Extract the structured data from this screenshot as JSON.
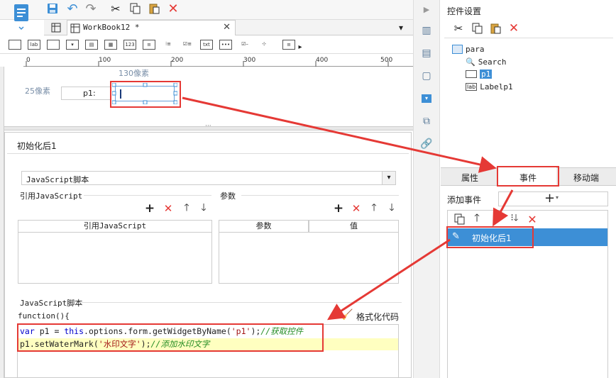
{
  "toolbar": {
    "tab_title": "WorkBook12 *"
  },
  "ruler": {
    "ticks": [
      "0",
      "100",
      "200",
      "300",
      "400",
      "500"
    ]
  },
  "canvas": {
    "width_label": "130像素",
    "height_label": "25像素",
    "param_label": "p1:"
  },
  "editor": {
    "panel_title": "初始化后1",
    "script_type": "JavaScript脚本",
    "ref_section": "引用JavaScript",
    "param_section": "参数",
    "ref_col": "引用JavaScript",
    "param_col": "参数",
    "value_col": "值",
    "script_section": "JavaScript脚本",
    "func_header": "function(){",
    "format_label": "格式化代码",
    "code": {
      "line1_kw": "var",
      "line1_a": " p1 = ",
      "line1_this": "this",
      "line1_b": ".options.form.getWidgetByName(",
      "line1_str": "'p1'",
      "line1_c": ");",
      "line1_cmt": "//获取控件",
      "line2_a": "p1.setWaterMark(",
      "line2_str": "'水印文字'",
      "line2_b": ");",
      "line2_cmt": "//添加水印文字"
    }
  },
  "right_panel": {
    "title": "控件设置",
    "tree": {
      "root": "para",
      "search": "Search",
      "p1": "p1",
      "label": "Labelp1"
    },
    "tabs": {
      "attr": "属性",
      "event": "事件",
      "mobile": "移动端"
    },
    "add_event": "添加事件",
    "event_item": "初始化后1"
  },
  "colors": {
    "accent": "#3d8fd6",
    "selection": "#3d8fd6",
    "highlight": "#e53935",
    "code_line": "#ffffc0"
  }
}
